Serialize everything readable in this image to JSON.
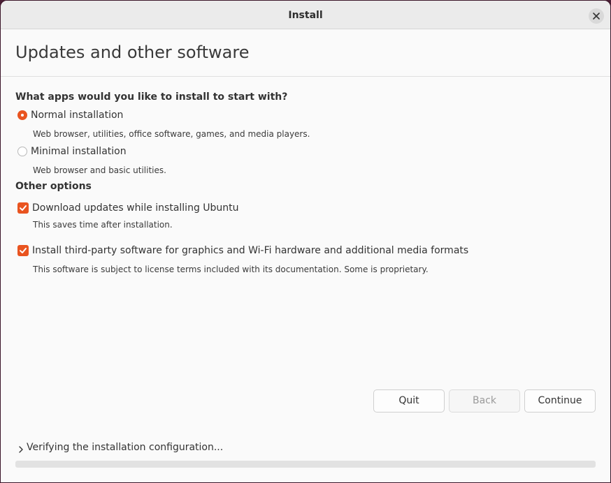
{
  "window": {
    "title": "Install",
    "close_icon": "close-icon"
  },
  "page": {
    "title": "Updates and other software"
  },
  "install_type": {
    "heading": "What apps would you like to install to start with?",
    "options": [
      {
        "label": "Normal installation",
        "description": "Web browser, utilities, office software, games, and media players.",
        "selected": true
      },
      {
        "label": "Minimal installation",
        "description": "Web browser and basic utilities.",
        "selected": false
      }
    ]
  },
  "other_options": {
    "heading": "Other options",
    "items": [
      {
        "label": "Download updates while installing Ubuntu",
        "description": "This saves time after installation.",
        "checked": true
      },
      {
        "label": "Install third-party software for graphics and Wi-Fi hardware and additional media formats",
        "description": "This software is subject to license terms included with its documentation. Some is proprietary.",
        "checked": true
      }
    ]
  },
  "buttons": {
    "quit": "Quit",
    "back": "Back",
    "continue": "Continue"
  },
  "status": {
    "text": "Verifying the installation configuration...",
    "expander_icon": "chevron-right-icon",
    "progress": 0
  },
  "colors": {
    "accent": "#e95420"
  }
}
